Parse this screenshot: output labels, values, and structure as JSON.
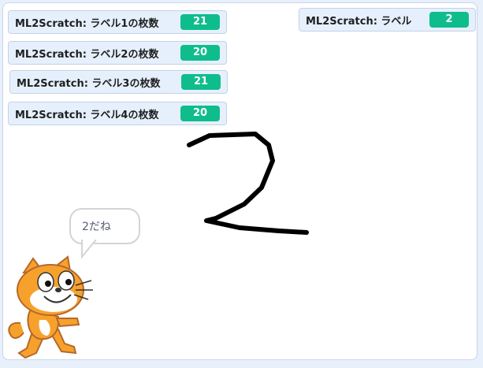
{
  "monitors": [
    {
      "label": "ML2Scratch: ラベル1の枚数",
      "value": "21"
    },
    {
      "label": "ML2Scratch: ラベル2の枚数",
      "value": "20"
    },
    {
      "label": "ML2Scratch: ラベル3の枚数",
      "value": "21"
    },
    {
      "label": "ML2Scratch: ラベル4の枚数",
      "value": "20"
    },
    {
      "label": "ML2Scratch: ラベル",
      "value": "2"
    }
  ],
  "sprite": {
    "speech": "2だね",
    "icon": "scratch-cat-icon"
  },
  "drawing": {
    "icon": "handwritten-digit-2",
    "color": "#000000"
  },
  "colors": {
    "monitor_value_bg": "#0fbd8c",
    "stage_bg": "#ffffff",
    "page_bg": "#e8f0fb"
  }
}
